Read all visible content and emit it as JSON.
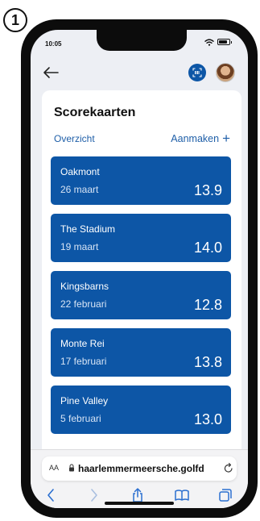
{
  "step_badge": "1",
  "status_bar": {
    "time": "10:05"
  },
  "header": {
    "back_label": "back",
    "scan_label": "scan",
    "avatar_label": "profile"
  },
  "page": {
    "title": "Scorekaarten",
    "tab_overview": "Overzicht",
    "create_label": "Aanmaken",
    "create_icon": "+"
  },
  "scorecards": [
    {
      "course": "Oakmont",
      "date": "26 maart",
      "score": "13.9"
    },
    {
      "course": "The Stadium",
      "date": "19 maart",
      "score": "14.0"
    },
    {
      "course": "Kingsbarns",
      "date": "22 februari",
      "score": "12.8"
    },
    {
      "course": "Monte Rei",
      "date": "17 februari",
      "score": "13.8"
    },
    {
      "course": "Pine Valley",
      "date": "5 februari",
      "score": "13.0"
    }
  ],
  "browser": {
    "text_size_label": "AA",
    "url": "haarlemmermeersche.golfd",
    "toolbar_icons": [
      "back-icon",
      "forward-icon",
      "share-icon",
      "bookmarks-icon",
      "tabs-icon"
    ]
  },
  "colors": {
    "accent": "#0d56a6",
    "link": "#1f5fa8",
    "background": "#edeff4"
  }
}
